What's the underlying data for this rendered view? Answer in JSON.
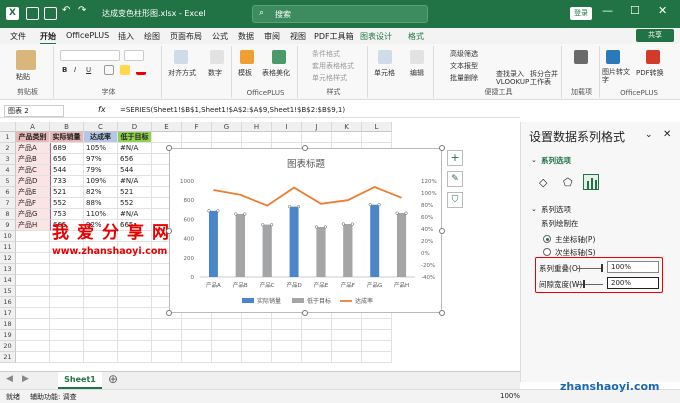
{
  "titlebar": {
    "app_icon": "X",
    "autosave_label": "",
    "filename": "达成变色柱形图.xlsx - Excel",
    "search_placeholder": "搜索",
    "login_label": "登录"
  },
  "menu": {
    "tabs": [
      "文件",
      "开始",
      "OfficePLUS",
      "插入",
      "绘图",
      "页面布局",
      "公式",
      "数据",
      "审阅",
      "视图",
      "PDF工具箱",
      "图表设计",
      "格式"
    ],
    "active_index": 1,
    "share_label": "共享"
  },
  "ribbon": {
    "groups": [
      {
        "label": "剪贴板",
        "buttons": [
          "粘贴"
        ]
      },
      {
        "label": "字体",
        "buttons": [
          "B",
          "I",
          "U"
        ]
      },
      {
        "label": "",
        "buttons": [
          "对齐方式",
          "数字"
        ]
      },
      {
        "label": "OfficePLUS",
        "buttons": [
          "模板",
          "表格美化"
        ]
      },
      {
        "label": "样式",
        "buttons": [
          "条件格式",
          "套用表格格式",
          "单元格样式"
        ]
      },
      {
        "label": "",
        "buttons": [
          "单元格",
          "编辑"
        ]
      },
      {
        "label": "便捷工具",
        "buttons": [
          "高级筛选",
          "文本报型",
          "批量删除",
          "查找录入VLOOKUP",
          "拆分合并工作表"
        ]
      },
      {
        "label": "加载项",
        "buttons": [
          "加载项"
        ]
      },
      {
        "label": "OfficePLUS",
        "buttons": [
          "图片转文字",
          "PDF转换"
        ]
      }
    ]
  },
  "formula_bar": {
    "name_box": "图表 2",
    "fx": "fx",
    "formula": "=SERIES(Sheet1!$B$1,Sheet1!$A$2:$A$9,Sheet1!$B$2:$B$9,1)"
  },
  "sheet": {
    "columns": [
      "A",
      "B",
      "C",
      "D",
      "E",
      "F",
      "G",
      "H",
      "I",
      "J",
      "K",
      "L"
    ],
    "rows": [
      "1",
      "2",
      "3",
      "4",
      "5",
      "6",
      "7",
      "8",
      "9",
      "10",
      "11",
      "12",
      "13",
      "14",
      "15",
      "16",
      "17",
      "18",
      "19",
      "20",
      "21"
    ],
    "headers": [
      "产品类别",
      "实际销量",
      "达成率",
      "低于目标"
    ],
    "data": [
      [
        "产品A",
        "689",
        "105%",
        "#N/A"
      ],
      [
        "产品B",
        "656",
        "97%",
        "656"
      ],
      [
        "产品C",
        "544",
        "79%",
        "544"
      ],
      [
        "产品D",
        "733",
        "109%",
        "#N/A"
      ],
      [
        "产品E",
        "521",
        "82%",
        "521"
      ],
      [
        "产品F",
        "552",
        "88%",
        "552"
      ],
      [
        "产品G",
        "753",
        "110%",
        "#N/A"
      ],
      [
        "产品H",
        "665",
        "92%",
        "665"
      ]
    ],
    "header_colors": [
      "#e6b8b7",
      "#e6b8b7",
      "#b4c7e7",
      "#92d050"
    ],
    "tab_name": "Sheet1"
  },
  "chart_data": {
    "type": "bar",
    "title": "图表标题",
    "categories": [
      "产品A",
      "产品B",
      "产品C",
      "产品D",
      "产品E",
      "产品F",
      "产品G",
      "产品H"
    ],
    "series": [
      {
        "name": "实际销量",
        "type": "bar",
        "values": [
          689,
          656,
          544,
          733,
          521,
          552,
          753,
          665
        ],
        "color": "#4a86c8"
      },
      {
        "name": "低于目标",
        "type": "bar",
        "values": [
          null,
          656,
          544,
          null,
          521,
          552,
          null,
          665
        ],
        "color": "#a5a5a5"
      },
      {
        "name": "达成率",
        "type": "line",
        "axis": "secondary",
        "values": [
          105,
          97,
          79,
          109,
          82,
          88,
          110,
          92
        ],
        "color": "#ed7d31"
      }
    ],
    "ylim": [
      0,
      1000
    ],
    "y_ticks": [
      "0",
      "200",
      "400",
      "600",
      "800",
      "1000"
    ],
    "y2lim": [
      -40,
      120
    ],
    "y2_ticks": [
      "-40%",
      "-20%",
      "0%",
      "20%",
      "40%",
      "60%",
      "80%",
      "100%",
      "120%"
    ],
    "legend_position": "bottom",
    "grid": false
  },
  "chart_side_buttons": [
    "+",
    "✎",
    "⛉"
  ],
  "watermark": {
    "line1": "我爱分享网",
    "line2": "www.zhanshaoyi.com",
    "corner": "zhanshaoyi.com"
  },
  "pane": {
    "title": "设置数据系列格式",
    "section_options": "系列选项",
    "section_series": "系列选项",
    "plot_on": "系列绘制在",
    "primary_axis": "主坐标轴(P)",
    "secondary_axis": "次坐标轴(S)",
    "overlap_label": "系列重叠(O)",
    "overlap_value": "100%",
    "gap_label": "间隙宽度(W)",
    "gap_value": "200%"
  },
  "status": {
    "ready": "就绪",
    "accessibility": "辅助功能: 调查",
    "zoom": "100%"
  },
  "colors": {
    "accent": "#217346",
    "highlight": "#e00000"
  }
}
